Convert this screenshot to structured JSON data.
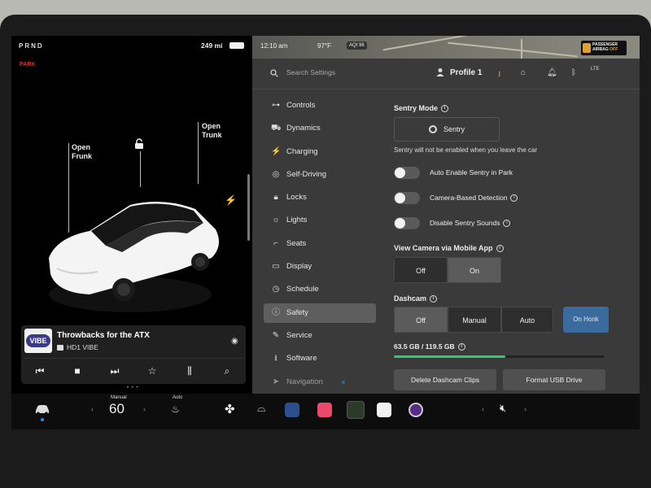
{
  "status": {
    "gear": "PRND",
    "park": "PARK",
    "range": "249 mi"
  },
  "car_panel": {
    "open_frunk": "Open\nFrunk",
    "open_trunk": "Open\nTrunk"
  },
  "media": {
    "logo_text": "VIBE",
    "title": "Throwbacks for the ATX",
    "source": "HD1 VIBE"
  },
  "map": {
    "time": "12:10 am",
    "temp": "97°F",
    "aqi": "AQI 96"
  },
  "airbag": {
    "line1": "PASSENGER",
    "line2": "AIRBAG",
    "state": "OFF"
  },
  "topbar": {
    "search_placeholder": "Search Settings",
    "profile": "Profile 1",
    "lte": "LTE"
  },
  "nav": [
    {
      "label": "Controls",
      "icon": "toggle-icon"
    },
    {
      "label": "Dynamics",
      "icon": "car-icon"
    },
    {
      "label": "Charging",
      "icon": "bolt-icon"
    },
    {
      "label": "Self-Driving",
      "icon": "steering-wheel-icon"
    },
    {
      "label": "Locks",
      "icon": "lock-icon"
    },
    {
      "label": "Lights",
      "icon": "light-icon"
    },
    {
      "label": "Seats",
      "icon": "seat-icon"
    },
    {
      "label": "Display",
      "icon": "display-icon"
    },
    {
      "label": "Schedule",
      "icon": "clock-icon"
    },
    {
      "label": "Safety",
      "icon": "alert-icon",
      "active": true
    },
    {
      "label": "Service",
      "icon": "wrench-icon"
    },
    {
      "label": "Software",
      "icon": "download-icon"
    },
    {
      "label": "Navigation",
      "icon": "navigation-icon"
    }
  ],
  "sentry": {
    "title": "Sentry Mode",
    "button": "Sentry",
    "note": "Sentry will not be enabled when you leave the car"
  },
  "toggles": [
    {
      "label": "Auto Enable Sentry in Park",
      "on": false
    },
    {
      "label": "Camera-Based Detection",
      "on": false,
      "info": true
    },
    {
      "label": "Disable Sentry Sounds",
      "on": false,
      "info": true
    }
  ],
  "view_camera": {
    "title": "View Camera via Mobile App",
    "options": [
      "Off",
      "On"
    ],
    "selected": "On"
  },
  "dashcam": {
    "title": "Dashcam",
    "options": [
      "Off",
      "Manual",
      "Auto"
    ],
    "selected": "Off",
    "on_honk": "On Honk"
  },
  "storage": {
    "text": "63.5 GB / 119.5 GB",
    "used_fraction": 0.53
  },
  "actions": {
    "delete": "Delete Dashcam Clips",
    "format": "Format USB Drive"
  },
  "dock": {
    "temp_mode": "Manual",
    "temp_value": "60",
    "seat_mode": "Auto"
  }
}
